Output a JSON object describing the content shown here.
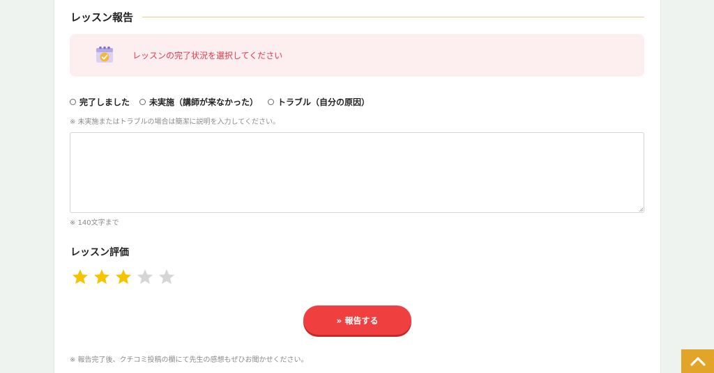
{
  "section": {
    "title": "レッスン報告"
  },
  "alert": {
    "icon": "calendar-check-icon",
    "message": "レッスンの完了状況を選択してください"
  },
  "status_options": [
    {
      "label": "完了しました",
      "selected": false
    },
    {
      "label": "未実施（講師が来なかった）",
      "selected": false
    },
    {
      "label": "トラブル（自分の原因）",
      "selected": false
    }
  ],
  "notes": {
    "explanation": "※ 未実施またはトラブルの場合は簡潔に説明を入力してください。",
    "char_limit": "※ 140文字まで",
    "footer": "※ 報告完了後、クチコミ投稿の欄にて先生の感想もぜひお聞かせください。"
  },
  "comment": {
    "value": ""
  },
  "rating": {
    "title": "レッスン評価",
    "value": 3,
    "max": 5
  },
  "submit": {
    "label": "» 報告する"
  },
  "colors": {
    "accent_red": "#ef3f3f",
    "alert_text": "#e4384c",
    "alert_bg": "#fdeff0",
    "star_on": "#f5c400",
    "star_off": "#d6d6d6",
    "pagetop_bg": "#e2a52a",
    "section_rule": "#e6cf8e"
  },
  "page_top": {
    "icon": "chevron-up-icon"
  }
}
